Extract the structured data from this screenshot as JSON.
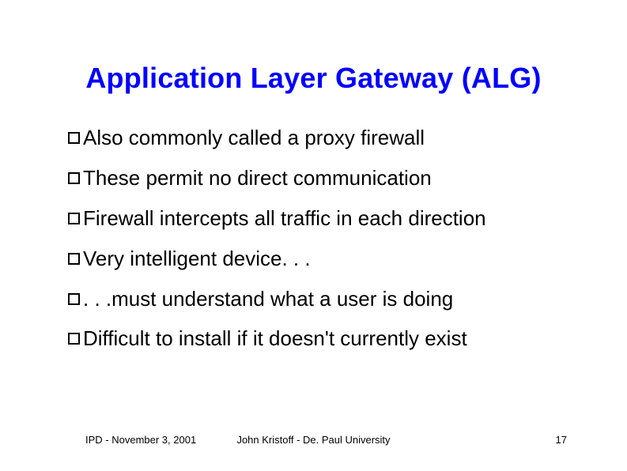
{
  "title": "Application Layer Gateway (ALG)",
  "bullets": [
    "Also commonly called a proxy firewall",
    "These permit no direct communication",
    "Firewall intercepts all traffic in each direction",
    "Very intelligent device. . .",
    ". . .must understand what a user is doing",
    "Difficult to install if it doesn't currently exist"
  ],
  "footer": {
    "left": "IPD - November 3, 2001",
    "center": "John Kristoff - De. Paul University",
    "right": "17"
  }
}
